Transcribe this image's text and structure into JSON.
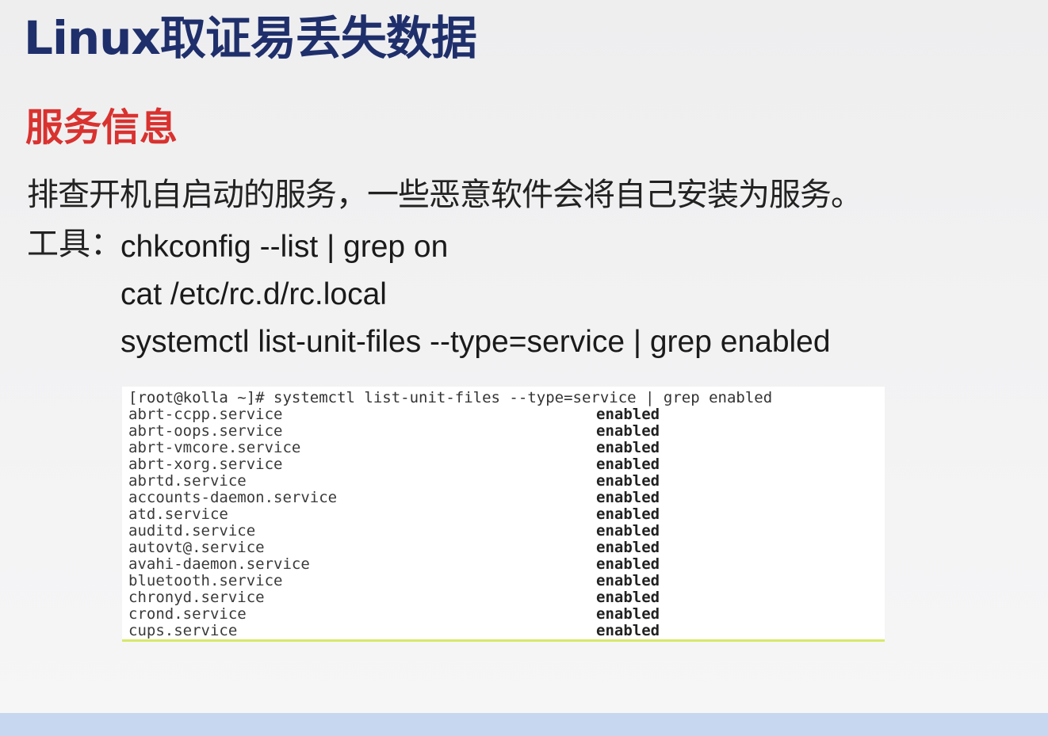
{
  "slide": {
    "title": "Linux取证易丢失数据",
    "section_heading": "服务信息",
    "description": "排查开机自启动的服务，一些恶意软件会将自己安装为服务。",
    "tools_label": "工具：",
    "commands": [
      "chkconfig --list | grep on",
      "cat /etc/rc.d/rc.local",
      "systemctl list-unit-files --type=service | grep enabled"
    ]
  },
  "terminal": {
    "prompt_line": "[root@kolla ~]# systemctl list-unit-files --type=service | grep enabled",
    "rows": [
      {
        "unit": "abrt-ccpp.service",
        "state": "enabled"
      },
      {
        "unit": "abrt-oops.service",
        "state": "enabled"
      },
      {
        "unit": "abrt-vmcore.service",
        "state": "enabled"
      },
      {
        "unit": "abrt-xorg.service",
        "state": "enabled"
      },
      {
        "unit": "abrtd.service",
        "state": "enabled"
      },
      {
        "unit": "accounts-daemon.service",
        "state": "enabled"
      },
      {
        "unit": "atd.service",
        "state": "enabled"
      },
      {
        "unit": "auditd.service",
        "state": "enabled"
      },
      {
        "unit": "autovt@.service",
        "state": "enabled"
      },
      {
        "unit": "avahi-daemon.service",
        "state": "enabled"
      },
      {
        "unit": "bluetooth.service",
        "state": "enabled"
      },
      {
        "unit": "chronyd.service",
        "state": "enabled"
      },
      {
        "unit": "crond.service",
        "state": "enabled"
      },
      {
        "unit": "cups.service",
        "state": "enabled"
      }
    ]
  },
  "colors": {
    "title": "#1f2f6b",
    "section_heading": "#d9322f"
  }
}
